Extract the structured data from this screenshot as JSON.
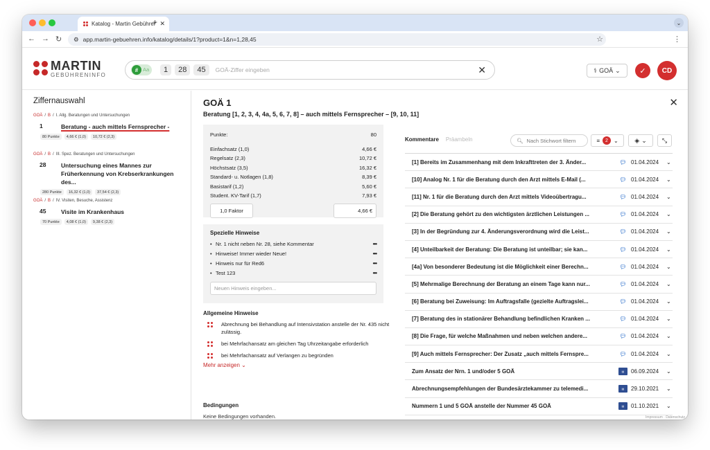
{
  "browser": {
    "tab_title": "Katalog - Martin Gebührenin",
    "url": "app.martin-gebuehren.info/katalog/details/1?product=1&n=1,28,45",
    "traffic": [
      "#ff5f57",
      "#febc2e",
      "#28c840"
    ]
  },
  "header": {
    "logo_name": "MARTIN",
    "logo_sub": "GEBÜHRENINFO",
    "toggle_hash": "#",
    "toggle_aa": "Aa",
    "chips": [
      "1",
      "28",
      "45"
    ],
    "search_placeholder": "GOÄ-Ziffer eingeben",
    "goa_select": "GOÄ",
    "avatar": "CD",
    "accent": "#d32f2f"
  },
  "left": {
    "title": "Ziffernauswahl",
    "groups": [
      {
        "crumb_a": "GOÄ",
        "crumb_b": "B",
        "crumb_c": "I. Allg. Beratungen und Untersuchungen",
        "nr": "1",
        "text": "Beratung - auch mittels Fernsprecher -",
        "pills": [
          "80 Punkte",
          "4,66 € (1,0)",
          "10,72 € (2,3)"
        ]
      },
      {
        "crumb_a": "GOÄ",
        "crumb_b": "B",
        "crumb_c": "III. Spez. Beratungen und Untersuchungen",
        "nr": "28",
        "text": "Untersuchung eines Mannes zur Früherkennung von Krebserkrankungen des...",
        "pills": [
          "280 Punkte",
          "16,32 € (1,0)",
          "37,54 € (2,3)"
        ]
      },
      {
        "crumb_a": "GOÄ",
        "crumb_b": "B",
        "crumb_c": "IV. Visiten, Besuche, Assistenz",
        "nr": "45",
        "text": "Visite im Krankenhaus",
        "pills": [
          "70 Punkte",
          "4,08 € (1,0)",
          "9,38 € (2,3)"
        ]
      }
    ]
  },
  "detail": {
    "title": "GOÄ 1",
    "subtitle": "Beratung [1, 2, 3, 4, 4a, 5, 6, 7, 8] – auch mittels Fernsprecher – [9, 10, 11]",
    "punkte_label": "Punkte:",
    "punkte_value": "80",
    "rates": [
      {
        "label": "Einfachsatz (1,0)",
        "value": "4,66 €"
      },
      {
        "label": "Regelsatz (2,3)",
        "value": "10,72 €"
      },
      {
        "label": "Höchstsatz (3,5)",
        "value": "16,32 €"
      },
      {
        "label": "Standard- u. Notlagen (1,8)",
        "value": "8,39 €"
      },
      {
        "label": "Basistarif (1,2)",
        "value": "5,60 €"
      },
      {
        "label": "Student. KV-Tarif (1,7)",
        "value": "7,93 €"
      }
    ],
    "factor_input": "1,0 Faktor",
    "factor_result": "4,66 €",
    "special_title": "Spezielle Hinweise",
    "special": [
      "Nr. 1 nicht neben Nr. 28, siehe Kommentar",
      "Hinweise! Immer wieder Neue!",
      "Hinweis nur für Red6",
      "Test 123"
    ],
    "new_hint_placeholder": "Neuen Hinweis eingeben...",
    "general_title": "Allgemeine Hinweise",
    "general": [
      "Abrechnung bei Behandlung auf Intensivstation anstelle der Nr. 435 nicht zulässig.",
      "bei Mehrfachansatz am gleichen Tag Uhrzeitangabe erforderlich",
      "bei Mehrfachansatz auf Verlangen zu begründen"
    ],
    "more_label": "Mehr anzeigen",
    "conditions_title": "Bedingungen",
    "conditions_text": "Keine Bedingungen vorhanden."
  },
  "comments": {
    "tab_active": "Kommentare",
    "tab_inactive": "Präambeln",
    "filter_placeholder": "Nach Stichwort filtern",
    "filter_count": "2",
    "items": [
      {
        "title": "[1] Bereits im Zusammenhang mit dem Inkrafttreten der 3. Änder...",
        "icon": "speech",
        "date": "01.04.2024"
      },
      {
        "title": "[10] Analog Nr. 1 für die Beratung durch den Arzt mittels E-Mail (...",
        "icon": "speech",
        "date": "01.04.2024"
      },
      {
        "title": "[11] Nr. 1 für die Beratung durch den Arzt mittels Videoübertragu...",
        "icon": "speech",
        "date": "01.04.2024"
      },
      {
        "title": "[2] Die Beratung gehört zu den wichtigsten ärztlichen Leistungen ...",
        "icon": "speech",
        "date": "01.04.2024"
      },
      {
        "title": "[3] In der Begründung zur 4. Änderungsverordnung wird die Leist...",
        "icon": "speech",
        "date": "01.04.2024"
      },
      {
        "title": "[4] Unteilbarkeit der Beratung: Die Beratung ist unteilbar; sie kan...",
        "icon": "speech",
        "date": "01.04.2024"
      },
      {
        "title": "[4a] Von besonderer Bedeutung ist die Möglichkeit einer Berechn...",
        "icon": "speech",
        "date": "01.04.2024"
      },
      {
        "title": "[5] Mehrmalige Berechnung der Beratung an einem Tage kann nur...",
        "icon": "speech",
        "date": "01.04.2024"
      },
      {
        "title": "[6] Beratung bei Zuweisung: Im Auftragsfalle (gezielte Auftragslei...",
        "icon": "speech",
        "date": "01.04.2024"
      },
      {
        "title": "[7] Beratung des in stationärer Behandlung befindlichen Kranken ...",
        "icon": "speech",
        "date": "01.04.2024"
      },
      {
        "title": "[8] Die Frage, für welche Maßnahmen und neben welchen andere...",
        "icon": "speech",
        "date": "01.04.2024"
      },
      {
        "title": "[9] Auch mittels Fernsprecher: Der Zusatz „auch mittels Fernspre...",
        "icon": "speech",
        "date": "01.04.2024"
      },
      {
        "title": "Zum Ansatz der Nrn. 1 und/oder 5 GOÄ",
        "icon": "doc",
        "date": "06.09.2024"
      },
      {
        "title": "Abrechnungsempfehlungen der Bundesärztekammer zu telemedi...",
        "icon": "doc",
        "date": "29.10.2021"
      },
      {
        "title": "Nummern 1 und 5 GOÄ anstelle der Nummer 45 GOÄ",
        "icon": "doc",
        "date": "01.10.2021"
      }
    ]
  },
  "footer": {
    "impressum": "Impressum · Datenschutz"
  }
}
